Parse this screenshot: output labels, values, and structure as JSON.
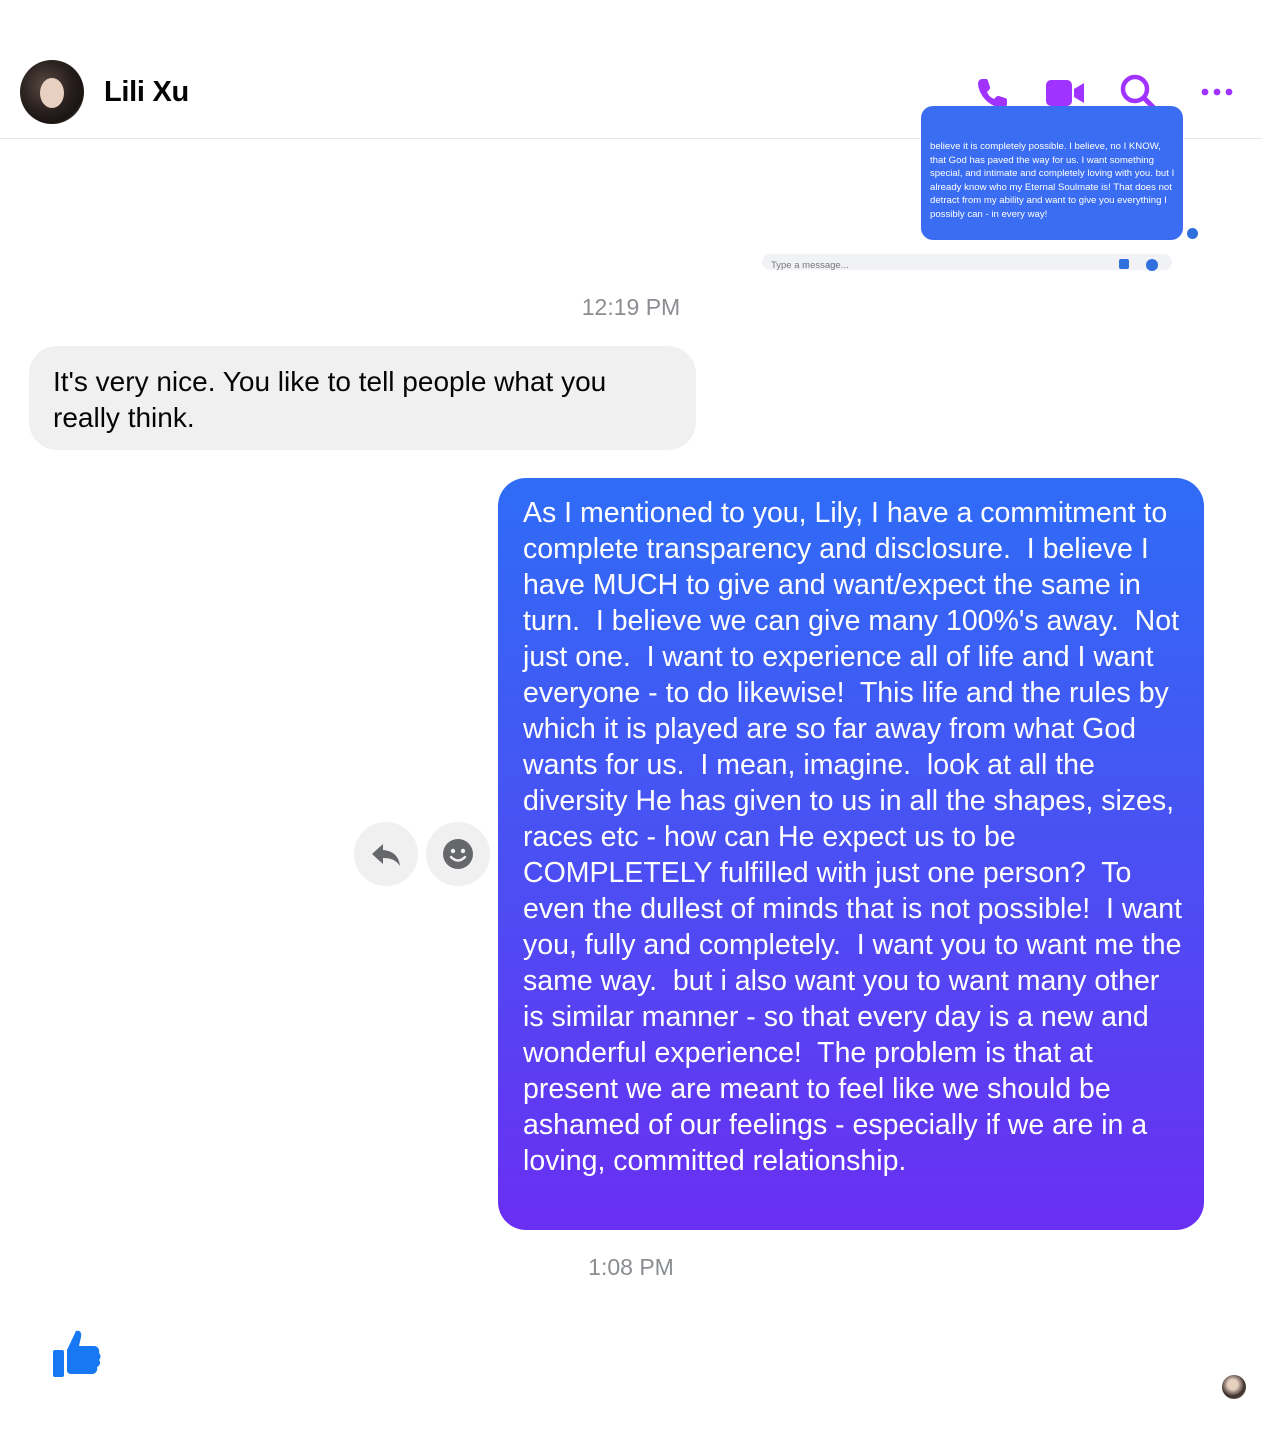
{
  "header": {
    "contact_name": "Lili Xu",
    "actions": [
      "phone-icon",
      "video-camera-icon",
      "search-icon",
      "more-options-icon"
    ],
    "accent_color": "#a033ff"
  },
  "background_screenshot": {
    "bubble_text": "believe it is completely possible. I believe, no I KNOW, that God has paved the way for us. I want something special, and intimate and completely loving with you. but I already know who my Eternal Soulmate is! That does not detract from my ability and want to give you everything I possibly can - in every way!",
    "input_placeholder": "Type a message..."
  },
  "messages": {
    "time_1": "12:19 PM",
    "incoming_1": "It's very nice. You like to tell people what you really think.",
    "outgoing_1": "As I mentioned to you, Lily, I have a commitment to complete transparency and disclosure.  I believe I have MUCH to give and want/expect the same in turn.  I believe we can give many 100%'s away.  Not just one.  I want to experience all of life and I want everyone - to do likewise!  This life and the rules by which it is played are so far away from what God wants for us.  I mean, imagine.  look at all the diversity He has given to us in all the shapes, sizes, races etc - how can He expect us to be COMPLETELY fulfilled with just one person?  To even the dullest of minds that is not possible!  I want you, fully and completely.  I want you to want me the same way.  but i also want you to want many other is similar manner - so that every day is a new and wonderful experience!  The problem is that at present we are meant to feel like we should be ashamed of our feelings - especially if we are in a loving, committed relationship.",
    "time_2": "1:08 PM",
    "outgoing_colors": [
      "#2f6cf6",
      "#6a2ff2"
    ]
  },
  "message_actions": [
    "reply-icon",
    "react-emoji-icon"
  ],
  "footer": {
    "like_icon": "thumbs-up-icon",
    "like_color": "#1877f2"
  }
}
